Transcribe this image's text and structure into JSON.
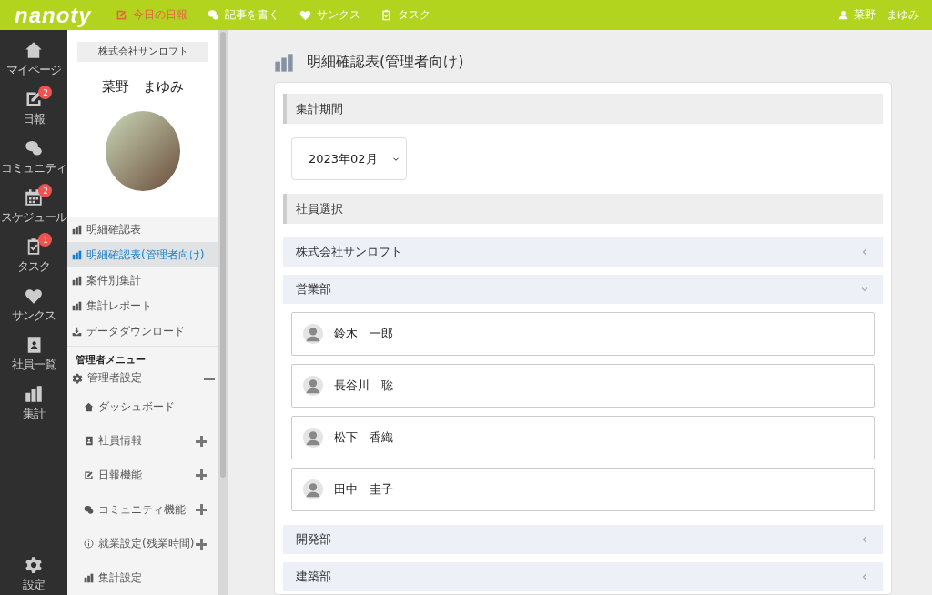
{
  "topbar": {
    "logo": "nanoty",
    "nav": [
      {
        "label": "今日の日報",
        "selected": true
      },
      {
        "label": "記事を書く",
        "selected": false
      },
      {
        "label": "サンクス",
        "selected": false
      },
      {
        "label": "タスク",
        "selected": false
      }
    ],
    "user": "菜野　まゆみ"
  },
  "rail": {
    "items": [
      {
        "label": "マイページ"
      },
      {
        "label": "日報",
        "badge": "2"
      },
      {
        "label": "コミュニティ"
      },
      {
        "label": "スケジュール",
        "badge": "2"
      },
      {
        "label": "タスク",
        "badge": "1"
      },
      {
        "label": "サンクス"
      },
      {
        "label": "社員一覧"
      },
      {
        "label": "集計"
      }
    ],
    "settings": "設定"
  },
  "sidebar": {
    "company": "株式会社サンロフト",
    "user_name": "菜野　まゆみ",
    "items": [
      {
        "label": "明細確認表",
        "selected": false
      },
      {
        "label": "明細確認表(管理者向け)",
        "selected": true
      },
      {
        "label": "案件別集計",
        "selected": false
      },
      {
        "label": "集計レポート",
        "selected": false
      },
      {
        "label": "データダウンロード",
        "selected": false
      }
    ],
    "admin_heading": "管理者メニュー",
    "admin_settings": {
      "label": "管理者設定",
      "expanded": true
    },
    "admin_items": [
      {
        "label": "ダッシュボード"
      },
      {
        "label": "社員情報",
        "expanded": false
      },
      {
        "label": "日報機能",
        "expanded": false
      },
      {
        "label": "コミュニティ機能",
        "expanded": false
      },
      {
        "label": "就業設定(残業時間)",
        "expanded": false
      },
      {
        "label": "集計設定"
      }
    ]
  },
  "main": {
    "title": "明細確認表(管理者向け)",
    "period_heading": "集計期間",
    "period_value": "2023年02月",
    "employee_heading": "社員選択",
    "departments": [
      {
        "name": "株式会社サンロフト",
        "expanded": false
      },
      {
        "name": "営業部",
        "expanded": true,
        "members": [
          "鈴木　一郎",
          "長谷川　聡",
          "松下　香織",
          "田中　圭子"
        ]
      },
      {
        "name": "開発部",
        "expanded": false
      },
      {
        "name": "建築部",
        "expanded": false
      }
    ]
  }
}
